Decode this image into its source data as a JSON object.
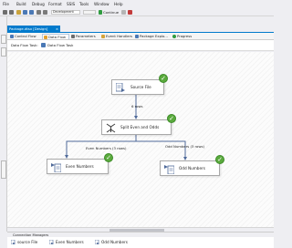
{
  "menubar": {
    "items": [
      "File",
      "Build",
      "Debug",
      "Format",
      "SSIS",
      "Tools",
      "Window",
      "Help"
    ]
  },
  "toolbar": {
    "config_dropdown": "Development",
    "continue_label": "Continue"
  },
  "document_tab": {
    "title": "Package.dtsx [Design]",
    "close_glyph": "×"
  },
  "designer_tabs": [
    {
      "label": "Control Flow",
      "active": false
    },
    {
      "label": "Data Flow",
      "active": true
    },
    {
      "label": "Parameters",
      "active": false
    },
    {
      "label": "Event Handlers",
      "active": false
    },
    {
      "label": "Package Explo...",
      "active": false
    },
    {
      "label": "Progress",
      "active": false
    }
  ],
  "task_bar": {
    "label": "Data Flow Task:",
    "selected_task": "Data Flow Task"
  },
  "canvas": {
    "nodes": {
      "source": {
        "label": "Source File",
        "icon": "flat-file-source-icon",
        "status": "success"
      },
      "split": {
        "label": "Split Even and Odds",
        "icon": "conditional-split-icon",
        "status": "success"
      },
      "even": {
        "label": "Even Numbers",
        "icon": "flat-file-destination-icon",
        "status": "success"
      },
      "odd": {
        "label": "Odd Numbers",
        "icon": "flat-file-destination-icon",
        "status": "success"
      }
    },
    "paths": {
      "source_to_split": "6 rows",
      "split_to_even": "Even Numbers (3 rows)",
      "split_to_odd": "Odd Numbers (3 rows)"
    }
  },
  "connection_managers": {
    "header": "Connection Managers",
    "items": [
      "source File",
      "Even Numbers",
      "Odd Numbers"
    ]
  },
  "colors": {
    "accent": "#007acc",
    "success": "#5aaa3d",
    "arrow": "#4f6a9a"
  }
}
